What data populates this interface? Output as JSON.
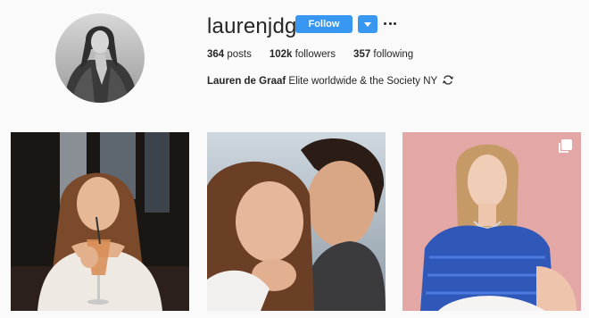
{
  "profile": {
    "username": "laurenjdg",
    "follow_label": "Follow",
    "dropdown_icon": "caret-down-icon",
    "more_icon": "ellipsis-icon",
    "avatar_icon": "avatar"
  },
  "stats": {
    "posts_count": "364",
    "posts_label": " posts",
    "followers_count": "102k",
    "followers_label": " followers",
    "following_count": "357",
    "following_label": " following"
  },
  "bio": {
    "full_name": "Lauren de Graaf",
    "text": " Elite worldwide & the Society NY ",
    "emoji_icon": "loop-arrows-icon"
  },
  "posts": [
    {
      "icon": "photo-girl-drinking"
    },
    {
      "icon": "photo-couple-selfie"
    },
    {
      "icon": "photo-model-blue-top",
      "badge_icon": "multiple-images-icon"
    }
  ],
  "colors": {
    "accent": "#3897f0",
    "background": "#fafafa",
    "text": "#262626"
  }
}
